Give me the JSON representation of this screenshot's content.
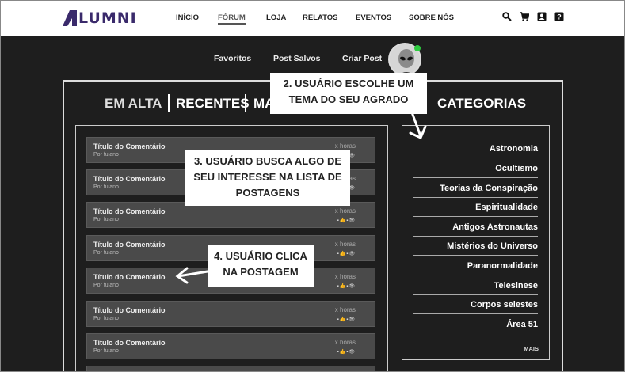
{
  "brand": {
    "logo_text": "LUMNI"
  },
  "nav": {
    "items": [
      "INÍCIO",
      "FÓRUM",
      "LOJA",
      "RELATOS",
      "EVENTOS",
      "SOBRE NÓS"
    ],
    "active": "FÓRUM",
    "icons": [
      "search-icon",
      "cart-icon",
      "profile-icon",
      "help-icon"
    ]
  },
  "subnav": {
    "favorites": "Favoritos",
    "saved": "Post Salvos",
    "create": "Criar Post"
  },
  "tabs": {
    "trending": "EM ALTA",
    "recent": "RECENTES",
    "partial": "MA",
    "categories": "CATEGORIAS"
  },
  "posts": [
    {
      "title": "Título do Comentário",
      "author": "Por fulano",
      "time": "x horas",
      "stats": "▪👍▪👁"
    },
    {
      "title": "Título do Comentário",
      "author": "Por fulano",
      "time": "x horas",
      "stats": "▪👍▪👁"
    },
    {
      "title": "Título do Comentário",
      "author": "Por fulano",
      "time": "x horas",
      "stats": "▪👍▪👁"
    },
    {
      "title": "Título do Comentário",
      "author": "Por fulano",
      "time": "x horas",
      "stats": "▪👍▪👁"
    },
    {
      "title": "Título do Comentário",
      "author": "Por fulano",
      "time": "x horas",
      "stats": "▪👍▪👁"
    },
    {
      "title": "Título do Comentário",
      "author": "Por fulano",
      "time": "x horas",
      "stats": "▪👍▪👁"
    },
    {
      "title": "Título do Comentário",
      "author": "Por fulano",
      "time": "x horas",
      "stats": "▪👍▪👁"
    }
  ],
  "categories": [
    "Astronomia",
    "Ocultismo",
    "Teorias da Conspiração",
    "Espiritualidade",
    "Antigos Astronautas",
    "Mistérios do Universo",
    "Paranormalidade",
    "Telesinese",
    "Corpos selestes",
    "Área 51"
  ],
  "categories_more": "MAIS",
  "annotations": {
    "step2": "2. USUÁRIO ESCOLHE UM TEMA DO SEU AGRADO",
    "step3": "3. USUÁRIO BUSCA ALGO DE SEU INTERESSE NA LISTA DE POSTAGENS",
    "step4": "4. USUÁRIO CLICA NA POSTAGEM"
  },
  "colors": {
    "background": "#1e1e1e",
    "post_bg": "#4a4a4a",
    "logo": "#3a2a6b",
    "online": "#2ecc40"
  }
}
